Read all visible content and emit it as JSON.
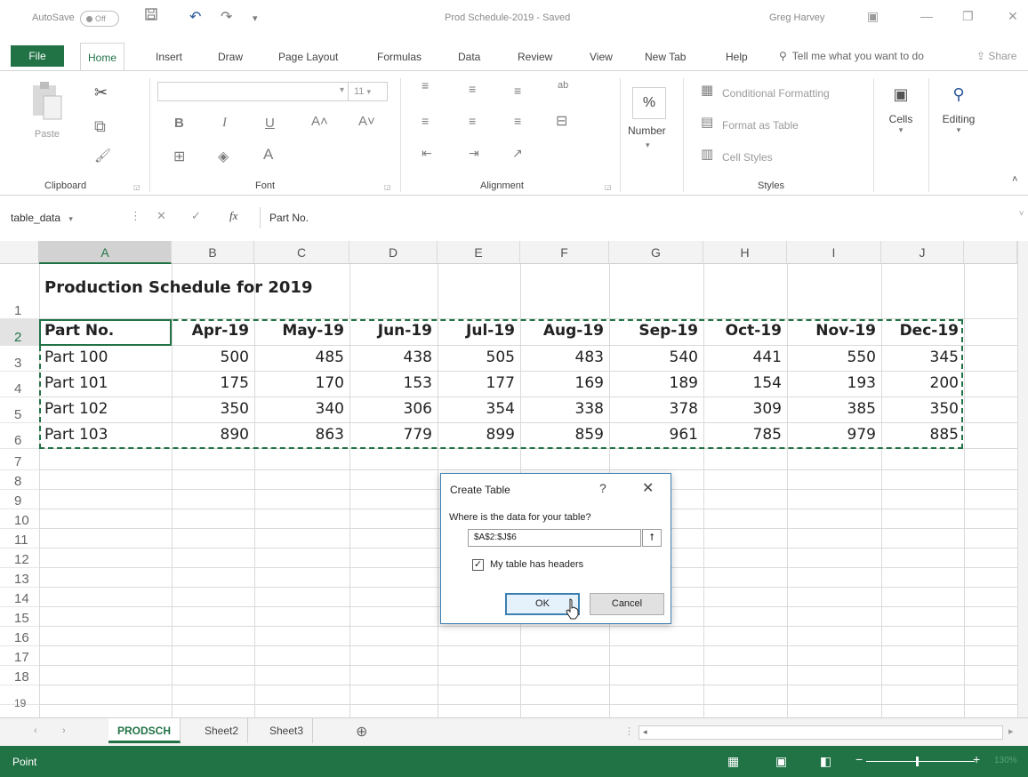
{
  "titlebar": {
    "autosave_label": "AutoSave",
    "autosave_state": "Off",
    "doc_title": "Prod Schedule-2019  -  Saved",
    "user_name": "Greg Harvey"
  },
  "ribbon_tabs": [
    "File",
    "Home",
    "Insert",
    "Draw",
    "Page Layout",
    "Formulas",
    "Data",
    "Review",
    "View",
    "New Tab",
    "Help"
  ],
  "tell_me": "Tell me what you want to do",
  "share": "Share",
  "ribbon": {
    "clipboard": {
      "label": "Clipboard",
      "paste": "Paste"
    },
    "font": {
      "label": "Font",
      "size": "11"
    },
    "alignment": {
      "label": "Alignment"
    },
    "number": {
      "label": "Number",
      "symbol": "%"
    },
    "styles": {
      "label": "Styles",
      "conditional": "Conditional Formatting",
      "format_table": "Format as Table",
      "cell_styles": "Cell Styles"
    },
    "cells": {
      "label": "Cells"
    },
    "editing": {
      "label": "Editing"
    }
  },
  "formula_bar": {
    "name_box": "table_data",
    "fx": "fx",
    "content": "Part No."
  },
  "grid": {
    "columns": [
      "A",
      "B",
      "C",
      "D",
      "E",
      "F",
      "G",
      "H",
      "I",
      "J"
    ],
    "rows": [
      "1",
      "2",
      "3",
      "4",
      "5",
      "6",
      "7",
      "8",
      "9",
      "10",
      "11",
      "12",
      "13",
      "14",
      "15",
      "16",
      "17",
      "18",
      "19"
    ],
    "title": "Production Schedule for 2019",
    "headers": [
      "Part No.",
      "Apr-19",
      "May-19",
      "Jun-19",
      "Jul-19",
      "Aug-19",
      "Sep-19",
      "Oct-19",
      "Nov-19",
      "Dec-19"
    ],
    "data": [
      [
        "Part 100",
        "500",
        "485",
        "438",
        "505",
        "483",
        "540",
        "441",
        "550",
        "345"
      ],
      [
        "Part 101",
        "175",
        "170",
        "153",
        "177",
        "169",
        "189",
        "154",
        "193",
        "200"
      ],
      [
        "Part 102",
        "350",
        "340",
        "306",
        "354",
        "338",
        "378",
        "309",
        "385",
        "350"
      ],
      [
        "Part 103",
        "890",
        "863",
        "779",
        "899",
        "859",
        "961",
        "785",
        "979",
        "885"
      ]
    ]
  },
  "sheets": {
    "tabs": [
      "PRODSCH",
      "Sheet2",
      "Sheet3"
    ],
    "add": "⊕"
  },
  "status": {
    "mode": "Point",
    "zoom": "130%"
  },
  "dialog": {
    "title": "Create Table",
    "help": "?",
    "close": "✕",
    "prompt": "Where is the data for your table?",
    "range": "$A$2:$J$6",
    "collapse": "⭡",
    "checkbox_label": "My table has headers",
    "checked": "✓",
    "ok": "OK",
    "cancel": "Cancel"
  },
  "colors": {
    "excel_green": "#217346",
    "dialog_blue": "#3c7fb1"
  }
}
